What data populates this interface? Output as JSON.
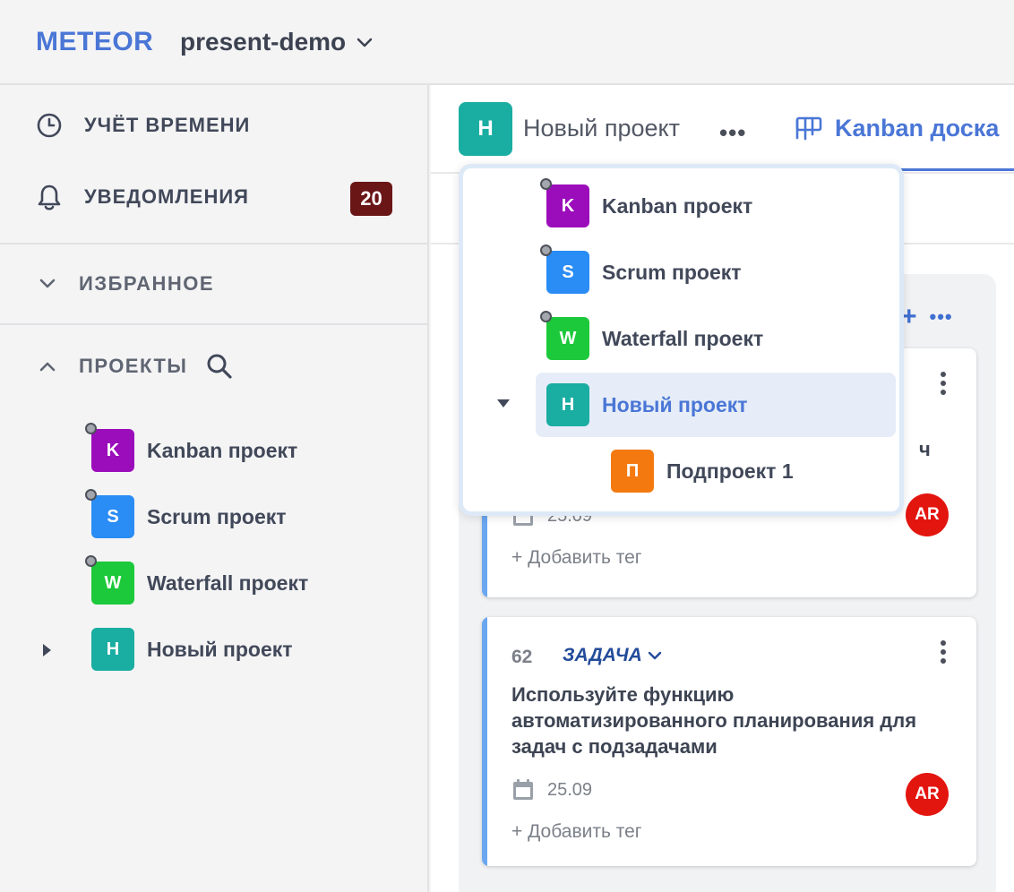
{
  "app": {
    "logo": "METEOR",
    "workspace": "present-demo"
  },
  "sidebar": {
    "time_tracking": "УЧЁТ ВРЕМЕНИ",
    "notifications": "УВЕДОМЛЕНИЯ",
    "notifications_count": "20",
    "favorites": "ИЗБРАННОЕ",
    "projects": "ПРОЕКТЫ",
    "project_list": [
      {
        "initial": "K",
        "name": "Kanban проект",
        "color": "#9b0dba"
      },
      {
        "initial": "S",
        "name": "Scrum проект",
        "color": "#2a8cf5"
      },
      {
        "initial": "W",
        "name": "Waterfall проект",
        "color": "#1cc93a"
      },
      {
        "initial": "H",
        "name": "Новый проект",
        "color": "#1aada2"
      }
    ]
  },
  "main": {
    "project_initial": "H",
    "project_title": "Новый проект",
    "more": "•••",
    "tab_kanban": "Kanban доска"
  },
  "dropdown": {
    "items": [
      {
        "initial": "K",
        "name": "Kanban проект",
        "color": "#9b0dba"
      },
      {
        "initial": "S",
        "name": "Scrum проект",
        "color": "#2a8cf5"
      },
      {
        "initial": "W",
        "name": "Waterfall проект",
        "color": "#1cc93a"
      },
      {
        "initial": "H",
        "name": "Новый проект",
        "color": "#1aada2",
        "selected": true
      },
      {
        "initial": "П",
        "name": "Подпроект 1",
        "color": "#f47a10"
      }
    ]
  },
  "column": {
    "add": "+",
    "more": "•••"
  },
  "cards": [
    {
      "partial_text": "ч",
      "date": "25.09",
      "add_tag": "+ Добавить тег",
      "assignee": "AR"
    },
    {
      "id": "62",
      "type": "ЗАДАЧА",
      "title": "Используйте функцию автоматизированного планирования для задач с подзадачами",
      "date": "25.09",
      "add_tag": "+ Добавить тег",
      "assignee": "AR"
    }
  ],
  "colors": {
    "accent": "#4a76d6",
    "badge": "#6b1616",
    "avatar_red": "#e3150f",
    "card_stripe": "#6aa7f0"
  }
}
